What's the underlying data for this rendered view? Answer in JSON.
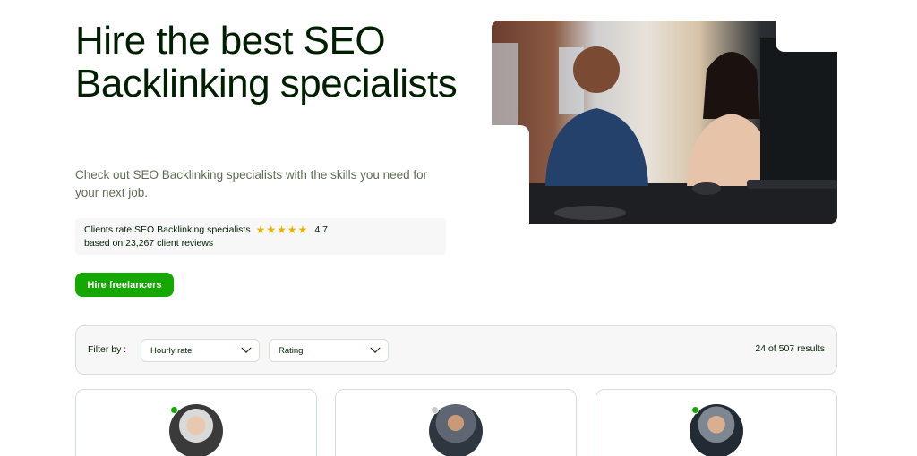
{
  "hero": {
    "title": "Hire the best SEO Backlinking specialists",
    "subtitle": "Check out SEO Backlinking specialists with the skills you need for your next job.",
    "rating_label": "Clients rate SEO Backlinking specialists",
    "rating_stars": 5,
    "rating_score": "4.7",
    "rating_basis": "based on 23,267 client reviews",
    "cta_label": "Hire freelancers"
  },
  "filters": {
    "label": "Filter by :",
    "options": [
      {
        "label": "Hourly rate"
      },
      {
        "label": "Rating"
      }
    ],
    "results": "24 of 507 results"
  },
  "cards": [
    {
      "status": "online"
    },
    {
      "status": "offline"
    },
    {
      "status": "online"
    }
  ],
  "colors": {
    "brand_green": "#14a800",
    "star": "#e8b400",
    "text": "#001e00",
    "muted": "#5e6d55"
  }
}
